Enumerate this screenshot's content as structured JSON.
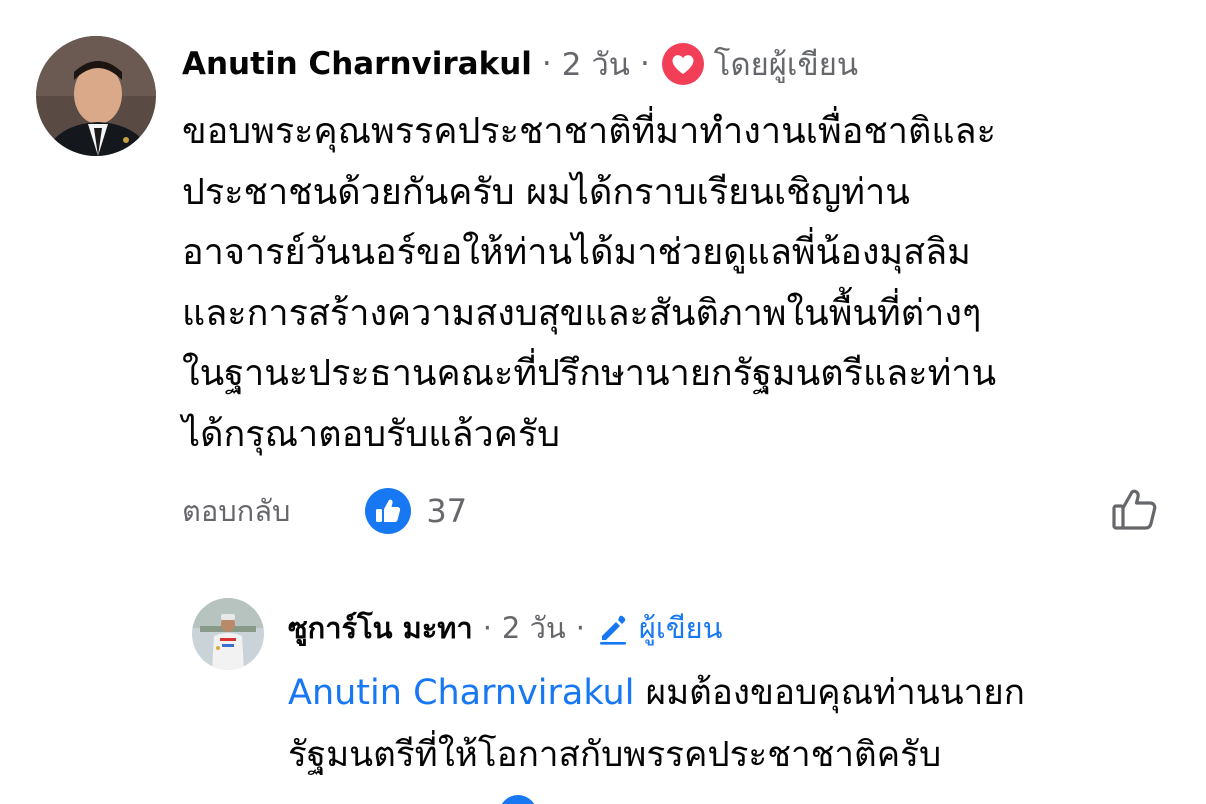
{
  "comment": {
    "author": "Anutin Charnvirakul",
    "time": "2 วัน",
    "separator": "·",
    "badge_label": "โดยผู้เขียน",
    "text": "ขอบพระคุณพรรคประชาชาติที่มาทำงานเพื่อชาติและ\nประชาชนด้วยกันครับ ผมได้กราบเรียนเชิญท่าน\nอาจารย์วันนอร์ขอให้ท่านได้มาช่วยดูแลพี่น้องมุสลิม\nและการสร้างความสงบสุขและสันติภาพในพื้นที่ต่างๆ\nในฐานะประธานคณะที่ปรึกษานายกรัฐมนตรีและท่าน\nได้กรุณาตอบรับแล้วครับ",
    "reply_label": "ตอบกลับ",
    "like_count": "37"
  },
  "reply": {
    "author": "ซูการ์โน มะทา",
    "time": "2 วัน",
    "separator": "·",
    "badge_label": "ผู้เขียน",
    "mention": "Anutin Charnvirakul",
    "text_rest": " ผมต้องขอบคุณท่านนายก\nรัฐมนตรีที่ให้โอกาสกับพรรคประชาชาติครับ"
  },
  "colors": {
    "like_blue": "#1877f2",
    "heart_red": "#f33e58",
    "secondary_text": "#65676b"
  },
  "icons": [
    "heart-icon",
    "like-icon",
    "thumbs-up-outline-icon",
    "pencil-icon"
  ]
}
